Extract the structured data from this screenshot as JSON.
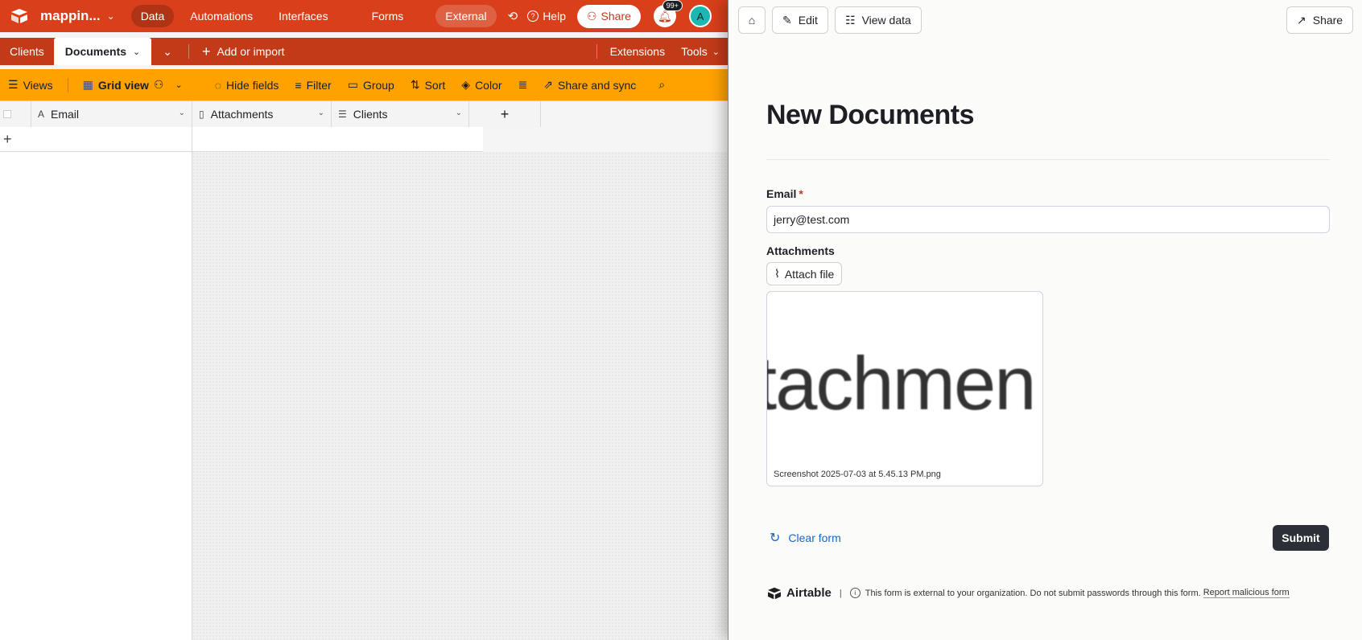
{
  "base": {
    "name": "mappin...",
    "nav": [
      "Data",
      "Automations",
      "Interfaces",
      "Forms",
      "External"
    ],
    "help": "Help",
    "share": "Share",
    "notif_badge": "99+",
    "avatar_initial": "A"
  },
  "tables": {
    "items": [
      "Clients",
      "Documents"
    ],
    "add_import": "Add or import",
    "extensions": "Extensions",
    "tools": "Tools"
  },
  "viewbar": {
    "views": "Views",
    "grid_view": "Grid view",
    "hide_fields": "Hide fields",
    "filter": "Filter",
    "group": "Group",
    "sort": "Sort",
    "color": "Color",
    "share_sync": "Share and sync"
  },
  "grid": {
    "columns": [
      "Email",
      "Attachments",
      "Clients"
    ]
  },
  "form": {
    "buttons": {
      "edit": "Edit",
      "view_data": "View data",
      "share": "Share"
    },
    "title": "New Documents",
    "email_label": "Email",
    "required_mark": "*",
    "email_value": "jerry@test.com",
    "attachments_label": "Attachments",
    "attach_file": "Attach file",
    "preview_text": "tachmen",
    "file_name": "Screenshot 2025-07-03 at 5.45.13 PM.png",
    "clear": "Clear form",
    "submit": "Submit",
    "brand": "Airtable",
    "notice": "This form is external to your organization. Do not submit passwords through this form.",
    "report": "Report malicious form"
  },
  "colors": {
    "topbar": "#d83f1a",
    "tabbar": "#c23a18",
    "viewbar": "#ffa200",
    "submit": "#2c2f36",
    "link": "#1a63c7"
  }
}
